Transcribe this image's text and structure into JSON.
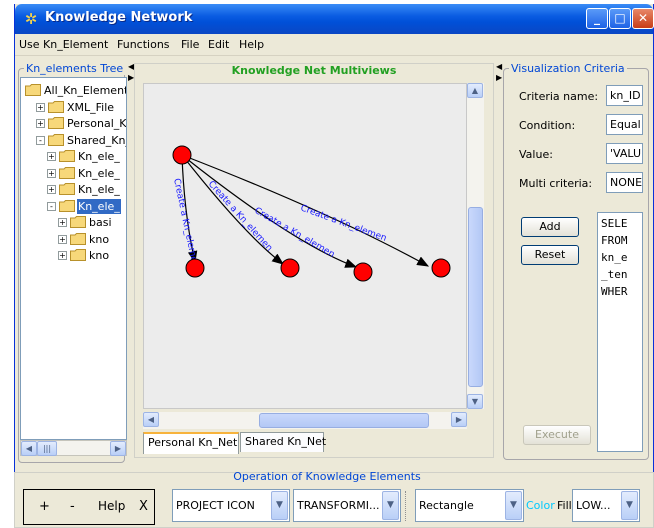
{
  "window": {
    "title": "Knowledge Network"
  },
  "menu": [
    "Use Kn_Element",
    "Functions",
    "File",
    "Edit",
    "Help"
  ],
  "tree": {
    "title": "Kn_elements Tree",
    "nodes": [
      {
        "label": "All_Kn_Elements",
        "level": 0,
        "expander": "",
        "selected": false
      },
      {
        "label": "XML_File",
        "level": 1,
        "expander": "+",
        "selected": false
      },
      {
        "label": "Personal_Kr",
        "level": 1,
        "expander": "+",
        "selected": false
      },
      {
        "label": "Shared_Kn_",
        "level": 1,
        "expander": "-",
        "selected": false
      },
      {
        "label": "Kn_ele_",
        "level": 2,
        "expander": "+",
        "selected": false
      },
      {
        "label": "Kn_ele_",
        "level": 2,
        "expander": "+",
        "selected": false
      },
      {
        "label": "Kn_ele_",
        "level": 2,
        "expander": "+",
        "selected": false
      },
      {
        "label": "Kn_ele_",
        "level": 2,
        "expander": "-",
        "selected": true
      },
      {
        "label": "basi",
        "level": 3,
        "expander": "+",
        "selected": false
      },
      {
        "label": "kno",
        "level": 3,
        "expander": "+",
        "selected": false
      },
      {
        "label": "kno",
        "level": 3,
        "expander": "+",
        "selected": false
      }
    ]
  },
  "multiviews": {
    "title": "Knowledge Net Multiviews",
    "edge_label": "Create a Kn_elemen",
    "tabs": [
      "Personal Kn_Net",
      "Shared Kn_Net"
    ],
    "active_tab": 0
  },
  "criteria": {
    "title": "Visualization Criteria",
    "fields": [
      {
        "label": "Criteria name:",
        "value": "kn_ID"
      },
      {
        "label": "Condition:",
        "value": "Equal:"
      },
      {
        "label": "Value:",
        "value": "'VALUE"
      },
      {
        "label": "Multi criteria:",
        "value": "NONE"
      }
    ],
    "add_label": "Add",
    "reset_label": "Reset",
    "execute_label": "Execute",
    "sql_text": "SELE\nFROM\nkn_e\n_ten\nWHER"
  },
  "operations": {
    "title": "Operation of Knowledge Elements",
    "plus": "+",
    "minus": "-",
    "help": "Help",
    "close": "X",
    "combo_icon": "PROJECT ICON",
    "combo_transform": "TRANSFORMI...",
    "combo_shape": "Rectangle",
    "color_label": "Color",
    "fill_label": "Fill",
    "combo_fill": "LOW..."
  },
  "colors": {
    "node": "#ff0000",
    "edge_label": "#1a1aff",
    "mv_title": "#22a022",
    "color_label": "#00c8ff"
  }
}
